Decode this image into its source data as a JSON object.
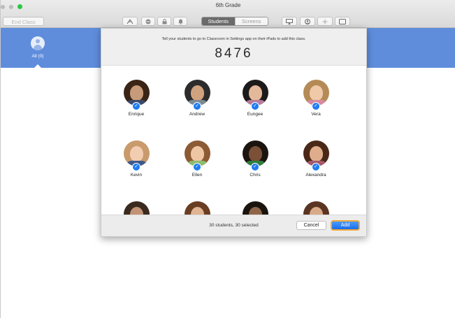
{
  "window": {
    "title": "6th Grade"
  },
  "toolbar": {
    "end_class_label": "End Class",
    "segments": [
      "Students",
      "Screens"
    ],
    "left_icons": [
      "apps-icon",
      "block-icon",
      "lock-icon",
      "mute-icon"
    ],
    "right_icons": [
      "airplay-icon",
      "hide-screen-icon",
      "add-icon",
      "ipad-icon"
    ]
  },
  "sidebar": {
    "all_label": "All (0)"
  },
  "sheet": {
    "instruction": "Tell your students to go to Classroom in Settings app on their iPads to add this class.",
    "code": "8476",
    "students": [
      {
        "name": "Enrique",
        "hair": "#3a2416",
        "skin": "#c79b7a",
        "shirt": "#3b4a6b"
      },
      {
        "name": "Andrew",
        "hair": "#2c2c2c",
        "skin": "#d0a27e",
        "shirt": "#7c8a93"
      },
      {
        "name": "Eungee",
        "hair": "#1d1a1a",
        "skin": "#e3b99a",
        "shirt": "#b87b9c"
      },
      {
        "name": "Vera",
        "hair": "#b48b56",
        "skin": "#f0c9a8",
        "shirt": "#d88aa1"
      },
      {
        "name": "Kevin",
        "hair": "#c89a6c",
        "skin": "#f2cdb0",
        "shirt": "#3e5a8c"
      },
      {
        "name": "Ellen",
        "hair": "#8c5a34",
        "skin": "#efc6a4",
        "shirt": "#8bbd6f"
      },
      {
        "name": "Chris",
        "hair": "#1b140f",
        "skin": "#7a5036",
        "shirt": "#2f7d3f"
      },
      {
        "name": "Alexandra",
        "hair": "#4a2818",
        "skin": "#e0ad8c",
        "shirt": "#a45a6c"
      },
      {
        "name": "",
        "hair": "#3a2a1e",
        "skin": "#c39375",
        "shirt": "#555"
      },
      {
        "name": "",
        "hair": "#6a3e22",
        "skin": "#e1b493",
        "shirt": "#555"
      },
      {
        "name": "",
        "hair": "#1a1410",
        "skin": "#8f6548",
        "shirt": "#555"
      },
      {
        "name": "",
        "hair": "#5a3522",
        "skin": "#d9aa88",
        "shirt": "#555"
      }
    ],
    "footer": {
      "count_text": "30 students, 30 selected",
      "cancel_label": "Cancel",
      "add_label": "Add"
    }
  }
}
